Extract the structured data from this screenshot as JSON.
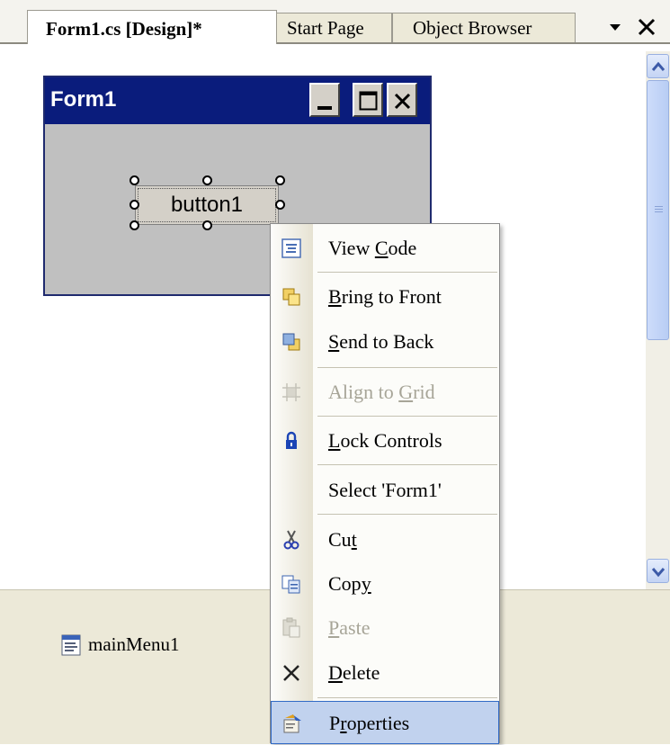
{
  "tabs": [
    {
      "label": "Form1.cs [Design]*",
      "active": true
    },
    {
      "label": "Start Page",
      "active": false
    },
    {
      "label": "Object Browser",
      "active": false
    }
  ],
  "tab_controls": {
    "dropdown_icon": "chevron-down-icon",
    "close_icon": "close-icon"
  },
  "form": {
    "title": "Form1",
    "button_text": "button1",
    "title_bar_color": "#0a1c7c"
  },
  "tray": {
    "items": [
      {
        "label": "mainMenu1",
        "icon": "main-menu-icon"
      }
    ]
  },
  "context_menu": {
    "items": [
      {
        "label": "View Code",
        "mnemonic": "C",
        "icon": "view-code-icon",
        "enabled": true
      },
      {
        "label": "Bring to Front",
        "mnemonic": "B",
        "icon": "bring-to-front-icon",
        "enabled": true
      },
      {
        "label": "Send to Back",
        "mnemonic": "S",
        "icon": "send-to-back-icon",
        "enabled": true
      },
      {
        "label": "Align to Grid",
        "mnemonic": "G",
        "icon": "align-to-grid-icon",
        "enabled": false
      },
      {
        "label": "Lock Controls",
        "mnemonic": "L",
        "icon": "lock-icon",
        "enabled": true
      },
      {
        "label": "Select 'Form1'",
        "mnemonic": "",
        "icon": "",
        "enabled": true
      },
      {
        "label": "Cut",
        "mnemonic": "t",
        "icon": "cut-icon",
        "enabled": true
      },
      {
        "label": "Copy",
        "mnemonic": "y",
        "icon": "copy-icon",
        "enabled": true
      },
      {
        "label": "Paste",
        "mnemonic": "P",
        "icon": "paste-icon",
        "enabled": false
      },
      {
        "label": "Delete",
        "mnemonic": "D",
        "icon": "delete-icon",
        "enabled": true
      },
      {
        "label": "Properties",
        "mnemonic": "r",
        "icon": "properties-icon",
        "enabled": true,
        "highlighted": true
      }
    ],
    "highlight_color": "#c1d2ee"
  }
}
